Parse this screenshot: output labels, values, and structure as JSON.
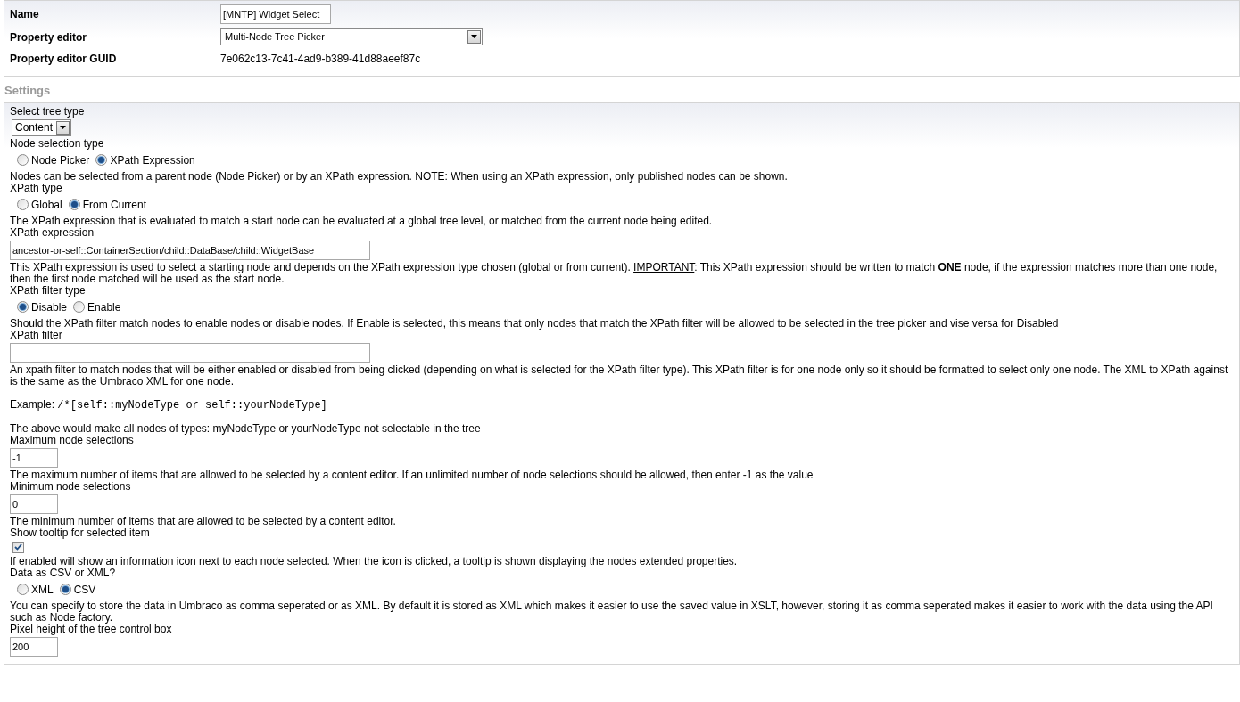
{
  "properties": [
    {
      "kind": "text",
      "label": "Name",
      "value": "[MNTP] Widget Select"
    },
    {
      "kind": "select",
      "label": "Property editor",
      "value": "Multi-Node Tree Picker"
    },
    {
      "kind": "static",
      "label": "Property editor GUID",
      "value": "7e062c13-7c41-4ad9-b389-41d88aeef87c"
    }
  ],
  "settings_title": "Settings",
  "settings": [
    {
      "label": "Select tree type",
      "kind": "select",
      "value": "Content"
    },
    {
      "label": "Node selection type",
      "kind": "radio",
      "options": [
        {
          "label": "Node Picker",
          "selected": false
        },
        {
          "label": "XPath Expression",
          "selected": true
        }
      ],
      "help": [
        [
          {
            "kind": "plain",
            "text": "Nodes can be selected from a parent node (Node Picker) or by an XPath expression. NOTE: When using an XPath expression, only published nodes can be shown."
          }
        ]
      ]
    },
    {
      "label": "XPath type",
      "kind": "radio",
      "options": [
        {
          "label": "Global",
          "selected": false
        },
        {
          "label": "From Current",
          "selected": true
        }
      ],
      "help": [
        [
          {
            "kind": "plain",
            "text": "The XPath expression that is evaluated to match a start node can be evaluated at a global tree level, or matched from the current node being edited."
          }
        ]
      ]
    },
    {
      "label": "XPath expression",
      "kind": "wide-text",
      "value": "ancestor-or-self::ContainerSection/child::DataBase/child::WidgetBase",
      "help": [
        [
          {
            "kind": "plain",
            "text": "This XPath expression is used to select a starting node and depends on the XPath expression type chosen (global or from current). "
          },
          {
            "kind": "underline",
            "text": "IMPORTANT"
          },
          {
            "kind": "plain",
            "text": ": This XPath expression should be written to match **ONE** node, if the expression matches more than one node, then the first node matched will be used as the start node."
          }
        ]
      ]
    },
    {
      "label": "XPath filter type",
      "kind": "radio",
      "options": [
        {
          "label": "Disable",
          "selected": true
        },
        {
          "label": "Enable",
          "selected": false
        }
      ],
      "help": [
        [
          {
            "kind": "plain",
            "text": "Should the XPath filter match nodes to enable nodes or disable nodes. If Enable is selected, this means that only nodes that match the XPath filter will be allowed to be selected in the tree picker and vise versa for Disabled"
          }
        ]
      ]
    },
    {
      "label": "XPath filter",
      "kind": "wide-text",
      "help": [
        [
          {
            "kind": "plain",
            "text": "An xpath filter to match nodes that will be either enabled or disabled from being clicked (depending on what is selected for the XPath filter type). This XPath filter is for one node only so it should be formatted to select only one node. The XML to XPath against is the same as the Umbraco XML for one node."
          }
        ],
        [
          {
            "kind": "plain",
            "text": "Example: "
          },
          {
            "kind": "code",
            "text": "/*[self::myNodeType or self::yourNodeType]"
          }
        ],
        [
          {
            "kind": "plain",
            "text": "The above would make all nodes of types: myNodeType or yourNodeType not selectable in the tree"
          }
        ]
      ]
    },
    {
      "label": "Maximum node selections",
      "kind": "short-text",
      "value": "-1",
      "help": [
        [
          {
            "kind": "plain",
            "text": "The maximum number of items that are allowed to be selected by a content editor. If an unlimited number of node selections should be allowed, then enter -1 as the value"
          }
        ]
      ]
    },
    {
      "label": "Minimum node selections",
      "kind": "short-text",
      "value": "0",
      "help": [
        [
          {
            "kind": "plain",
            "text": "The minimum number of items that are allowed to be selected by a content editor."
          }
        ]
      ]
    },
    {
      "label": "Show tooltip for selected item",
      "kind": "checkbox",
      "checked": true,
      "help": [
        [
          {
            "kind": "plain",
            "text": "If enabled will show an information icon next to each node selected. When the icon is clicked, a tooltip is shown displaying the nodes extended properties."
          }
        ]
      ]
    },
    {
      "label": "Data as CSV or XML?",
      "kind": "radio",
      "options": [
        {
          "label": "XML",
          "selected": false
        },
        {
          "label": "CSV",
          "selected": true
        }
      ],
      "help": [
        [
          {
            "kind": "plain",
            "text": "You can specify to store the data in Umbraco as comma seperated or as XML. By default it is stored as XML which makes it easier to use the saved value in XSLT, however, storing it as comma seperated makes it easier to work with the data using the API such as Node factory."
          }
        ]
      ]
    },
    {
      "label": "Pixel height of the tree control box",
      "kind": "short-text",
      "value": "200"
    }
  ]
}
